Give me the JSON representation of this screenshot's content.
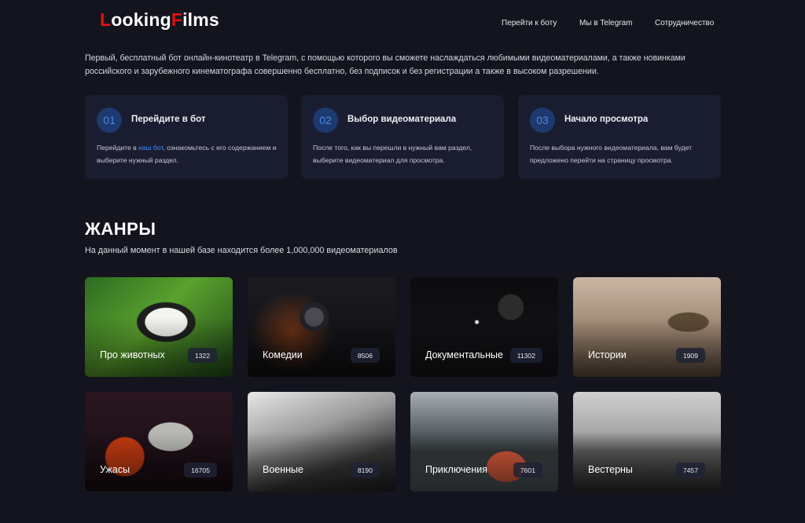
{
  "header": {
    "logo_part1": "L",
    "logo_part2": "ooking",
    "logo_part3": "F",
    "logo_part4": "ilms",
    "nav": [
      "Перейти к боту",
      "Мы в Telegram",
      "Сотрудничество"
    ]
  },
  "intro": "Первый, бесплатный бот онлайн-кинотеатр в Telegram, с помощью которого вы сможете наслаждаться любимыми видеоматериалами, а также новинками российского и зарубежного кинематографа совершенно бесплатно, без подписок и без регистрации а также в высоком разрешении.",
  "steps": [
    {
      "num": "01",
      "title": "Перейдите в бот",
      "desc_before": "Перейдите в ",
      "link": "наш бот",
      "desc_after": ", ознакомьтесь с его содержанием и выберите нужный раздел."
    },
    {
      "num": "02",
      "title": "Выбор видеоматериала",
      "desc": "После того, как вы перешли в нужный вам раздел, выберите видеоматериал для просмотра."
    },
    {
      "num": "03",
      "title": "Начало просмотра",
      "desc": "После выбора нужного видеоматериала, вам будет предложено перейти на страницу просмотра."
    }
  ],
  "genres": {
    "title": "ЖАНРЫ",
    "subtitle": "На данный момент в нашей базе находится более 1,000,000 видеоматериалов",
    "items": [
      {
        "label": "Про животных",
        "count": "1322"
      },
      {
        "label": "Комедии",
        "count": "8506"
      },
      {
        "label": "Документальные",
        "count": "11302"
      },
      {
        "label": "Истории",
        "count": "1909"
      },
      {
        "label": "Ужасы",
        "count": "16705"
      },
      {
        "label": "Военные",
        "count": "8190"
      },
      {
        "label": "Приключения",
        "count": "7601"
      },
      {
        "label": "Вестерны",
        "count": "7457"
      }
    ]
  },
  "colors": {
    "background": "#14141f",
    "card": "#1a1d30",
    "accent_red": "#e11212",
    "accent_blue": "#3f8cff"
  }
}
